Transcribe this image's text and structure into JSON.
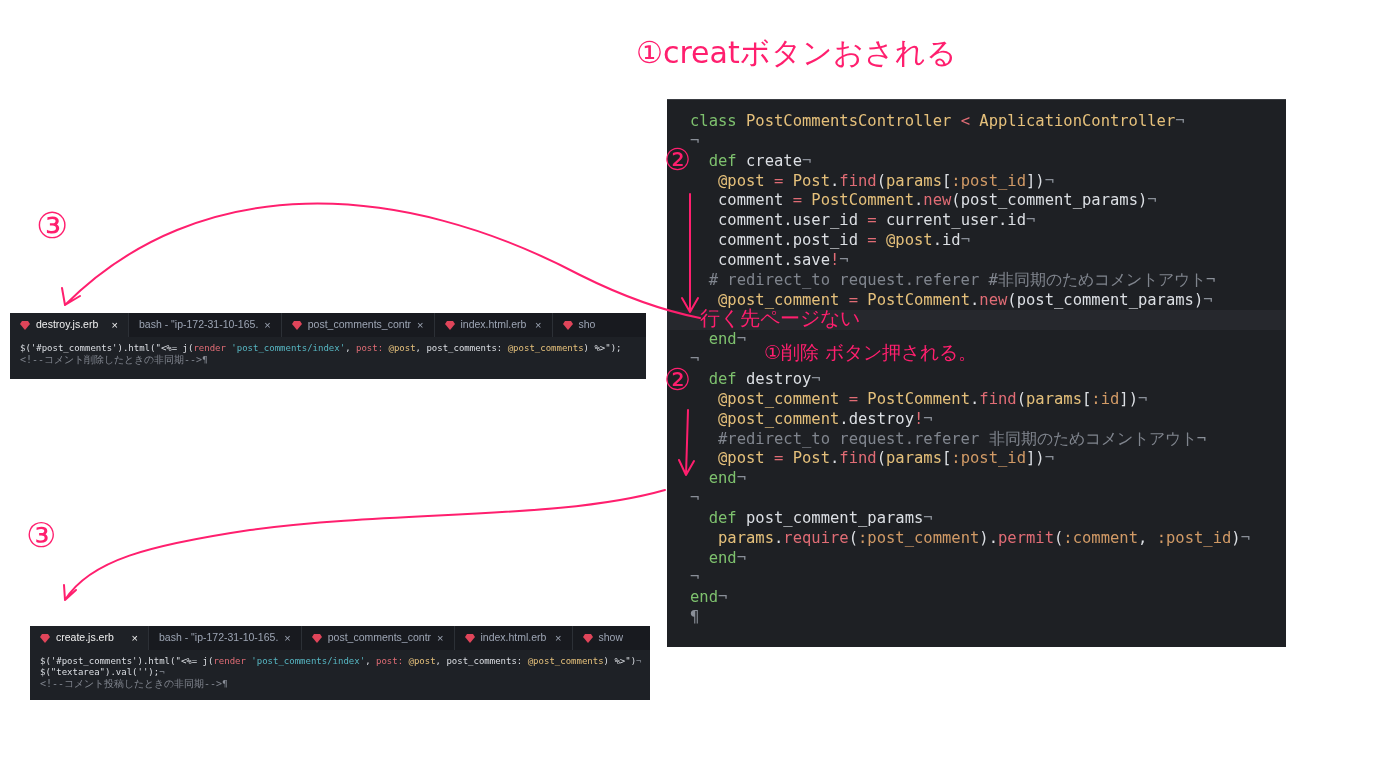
{
  "notes": [
    {
      "text": "①creatボタンおされる"
    },
    {
      "text": "②"
    },
    {
      "text": "行く先ページない"
    },
    {
      "text": "①削除 ボタン押される。"
    },
    {
      "text": "②"
    },
    {
      "text": "③"
    },
    {
      "text": "③"
    }
  ],
  "editor": {
    "lines": [
      {
        "tokens": [
          {
            "text": "class ",
            "kind": "kw"
          },
          {
            "text": "PostCommentsController",
            "kind": "cn"
          },
          {
            "text": " < ",
            "kind": "fn"
          },
          {
            "text": "ApplicationController",
            "kind": "cn"
          },
          {
            "text": "¬",
            "kind": "ws"
          }
        ]
      },
      {
        "tokens": [
          {
            "text": "¬",
            "kind": "ws"
          }
        ]
      },
      {
        "tokens": [
          {
            "text": "  def ",
            "kind": "kw"
          },
          {
            "text": "create",
            "kind": "tx"
          },
          {
            "text": "¬",
            "kind": "ws"
          }
        ]
      },
      {
        "tokens": [
          {
            "text": "   @post",
            "kind": "iv"
          },
          {
            "text": " = ",
            "kind": "fn"
          },
          {
            "text": "Post",
            "kind": "cn"
          },
          {
            "text": ".",
            "kind": "tx"
          },
          {
            "text": "find",
            "kind": "fn"
          },
          {
            "text": "(",
            "kind": "tx"
          },
          {
            "text": "params",
            "kind": "cn"
          },
          {
            "text": "[",
            "kind": "tx"
          },
          {
            "text": ":post_id",
            "kind": "sy"
          },
          {
            "text": "])",
            "kind": "tx"
          },
          {
            "text": "¬",
            "kind": "ws"
          }
        ]
      },
      {
        "tokens": [
          {
            "text": "   comment",
            "kind": "tx"
          },
          {
            "text": " = ",
            "kind": "fn"
          },
          {
            "text": "PostComment",
            "kind": "cn"
          },
          {
            "text": ".",
            "kind": "tx"
          },
          {
            "text": "new",
            "kind": "fn"
          },
          {
            "text": "(post_comment_params)",
            "kind": "tx"
          },
          {
            "text": "¬",
            "kind": "ws"
          }
        ]
      },
      {
        "tokens": [
          {
            "text": "   comment.user_id",
            "kind": "tx"
          },
          {
            "text": " = ",
            "kind": "fn"
          },
          {
            "text": "current_user.id",
            "kind": "tx"
          },
          {
            "text": "¬",
            "kind": "ws"
          }
        ]
      },
      {
        "tokens": [
          {
            "text": "   comment.post_id",
            "kind": "tx"
          },
          {
            "text": " = ",
            "kind": "fn"
          },
          {
            "text": "@post",
            "kind": "iv"
          },
          {
            "text": ".id",
            "kind": "tx"
          },
          {
            "text": "¬",
            "kind": "ws"
          }
        ]
      },
      {
        "tokens": [
          {
            "text": "   comment.save",
            "kind": "tx"
          },
          {
            "text": "!",
            "kind": "fn"
          },
          {
            "text": "¬",
            "kind": "ws"
          }
        ]
      },
      {
        "tokens": [
          {
            "text": "  # redirect_to request.referer #非同期のためコメントアウト",
            "kind": "cm"
          },
          {
            "text": "¬",
            "kind": "ws"
          }
        ]
      },
      {
        "tokens": [
          {
            "text": "   @post_comment",
            "kind": "iv"
          },
          {
            "text": " = ",
            "kind": "fn"
          },
          {
            "text": "PostComment",
            "kind": "cn"
          },
          {
            "text": ".",
            "kind": "tx"
          },
          {
            "text": "new",
            "kind": "fn"
          },
          {
            "text": "(post_comment_params)",
            "kind": "tx"
          },
          {
            "text": "¬",
            "kind": "ws"
          }
        ]
      },
      {
        "tokens": [
          {
            "text": "  end",
            "kind": "kw"
          },
          {
            "text": "¬",
            "kind": "ws"
          }
        ]
      },
      {
        "tokens": [
          {
            "text": "¬",
            "kind": "ws"
          }
        ]
      },
      {
        "tokens": [
          {
            "text": "  def ",
            "kind": "kw"
          },
          {
            "text": "destroy",
            "kind": "tx"
          },
          {
            "text": "¬",
            "kind": "ws"
          }
        ]
      },
      {
        "tokens": [
          {
            "text": "   @post_comment",
            "kind": "iv"
          },
          {
            "text": " = ",
            "kind": "fn"
          },
          {
            "text": "PostComment",
            "kind": "cn"
          },
          {
            "text": ".",
            "kind": "tx"
          },
          {
            "text": "find",
            "kind": "fn"
          },
          {
            "text": "(",
            "kind": "tx"
          },
          {
            "text": "params",
            "kind": "cn"
          },
          {
            "text": "[",
            "kind": "tx"
          },
          {
            "text": ":id",
            "kind": "sy"
          },
          {
            "text": "])",
            "kind": "tx"
          },
          {
            "text": "¬",
            "kind": "ws"
          }
        ]
      },
      {
        "tokens": [
          {
            "text": "   @post_comment",
            "kind": "iv"
          },
          {
            "text": ".destroy",
            "kind": "tx"
          },
          {
            "text": "!",
            "kind": "fn"
          },
          {
            "text": "¬",
            "kind": "ws"
          }
        ]
      },
      {
        "tokens": [
          {
            "text": "   #redirect_to request.referer 非同期のためコメントアウト",
            "kind": "cm"
          },
          {
            "text": "¬",
            "kind": "ws"
          }
        ]
      },
      {
        "tokens": [
          {
            "text": "   @post",
            "kind": "iv"
          },
          {
            "text": " = ",
            "kind": "fn"
          },
          {
            "text": "Post",
            "kind": "cn"
          },
          {
            "text": ".",
            "kind": "tx"
          },
          {
            "text": "find",
            "kind": "fn"
          },
          {
            "text": "(",
            "kind": "tx"
          },
          {
            "text": "params",
            "kind": "cn"
          },
          {
            "text": "[",
            "kind": "tx"
          },
          {
            "text": ":post_id",
            "kind": "sy"
          },
          {
            "text": "])",
            "kind": "tx"
          },
          {
            "text": "¬",
            "kind": "ws"
          }
        ]
      },
      {
        "tokens": [
          {
            "text": "  end",
            "kind": "kw"
          },
          {
            "text": "¬",
            "kind": "ws"
          }
        ]
      },
      {
        "tokens": [
          {
            "text": "¬",
            "kind": "ws"
          }
        ]
      },
      {
        "tokens": [
          {
            "text": "  def ",
            "kind": "kw"
          },
          {
            "text": "post_comment_params",
            "kind": "tx"
          },
          {
            "text": "¬",
            "kind": "ws"
          }
        ]
      },
      {
        "tokens": [
          {
            "text": "   params",
            "kind": "cn"
          },
          {
            "text": ".",
            "kind": "tx"
          },
          {
            "text": "require",
            "kind": "fn"
          },
          {
            "text": "(",
            "kind": "tx"
          },
          {
            "text": ":post_comment",
            "kind": "sy"
          },
          {
            "text": ").",
            "kind": "tx"
          },
          {
            "text": "permit",
            "kind": "fn"
          },
          {
            "text": "(",
            "kind": "tx"
          },
          {
            "text": ":comment",
            "kind": "sy"
          },
          {
            "text": ", ",
            "kind": "tx"
          },
          {
            "text": ":post_id",
            "kind": "sy"
          },
          {
            "text": ")",
            "kind": "tx"
          },
          {
            "text": "¬",
            "kind": "ws"
          }
        ]
      },
      {
        "tokens": [
          {
            "text": "  end",
            "kind": "kw"
          },
          {
            "text": "¬",
            "kind": "ws"
          }
        ]
      },
      {
        "tokens": [
          {
            "text": "¬",
            "kind": "ws"
          }
        ]
      },
      {
        "tokens": [
          {
            "text": "end",
            "kind": "kw"
          },
          {
            "text": "¬",
            "kind": "ws"
          }
        ]
      },
      {
        "tokens": [
          {
            "text": "¶",
            "kind": "ws"
          }
        ]
      }
    ]
  },
  "snippets": [
    {
      "tabs": [
        {
          "label": "destroy.js.erb",
          "selected": true,
          "kind": "file",
          "close": "×"
        },
        {
          "label": "bash - \"ip-172-31-10-165.",
          "selected": false,
          "kind": "terminal",
          "close": "×"
        },
        {
          "label": "post_comments_contr",
          "selected": false,
          "kind": "file",
          "close": "×"
        },
        {
          "label": "index.html.erb",
          "selected": false,
          "kind": "file",
          "close": "×"
        },
        {
          "label": "sho",
          "selected": false,
          "kind": "file"
        }
      ],
      "lines": [
        {
          "tokens": [
            {
              "text": "$('#post_comments').html(\"<%= j(",
              "kind": "tx"
            },
            {
              "text": "render ",
              "kind": "fn"
            },
            {
              "text": "'post_comments/index'",
              "kind": "st"
            },
            {
              "text": ", ",
              "kind": "tx"
            },
            {
              "text": "post: ",
              "kind": "fn"
            },
            {
              "text": "@post",
              "kind": "iv"
            },
            {
              "text": ", post_comments: ",
              "kind": "tx"
            },
            {
              "text": "@post_comments",
              "kind": "iv"
            },
            {
              "text": ") %>\");",
              "kind": "tx"
            }
          ]
        },
        {
          "tokens": [
            {
              "text": "<!--コメント削除したときの非同期-->",
              "kind": "cm"
            },
            {
              "text": "¶",
              "kind": "ws"
            }
          ]
        }
      ]
    },
    {
      "tabs": [
        {
          "label": "create.js.erb",
          "selected": true,
          "kind": "file",
          "close": "×"
        },
        {
          "label": "bash - \"ip-172-31-10-165.",
          "selected": false,
          "kind": "terminal",
          "close": "×"
        },
        {
          "label": "post_comments_contr",
          "selected": false,
          "kind": "file",
          "close": "×"
        },
        {
          "label": "index.html.erb",
          "selected": false,
          "kind": "file",
          "close": "×"
        },
        {
          "label": "show",
          "selected": false,
          "kind": "file"
        }
      ],
      "lines": [
        {
          "tokens": [
            {
              "text": "$('#post_comments').html(\"<%= j(",
              "kind": "tx"
            },
            {
              "text": "render ",
              "kind": "fn"
            },
            {
              "text": "'post_comments/index'",
              "kind": "st"
            },
            {
              "text": ", ",
              "kind": "tx"
            },
            {
              "text": "post: ",
              "kind": "fn"
            },
            {
              "text": "@post",
              "kind": "iv"
            },
            {
              "text": ", post_comments: ",
              "kind": "tx"
            },
            {
              "text": "@post_comments",
              "kind": "iv"
            },
            {
              "text": ") %>\")",
              "kind": "tx"
            },
            {
              "text": "¬",
              "kind": "ws"
            }
          ]
        },
        {
          "tokens": [
            {
              "text": "$(\"textarea\").val('');",
              "kind": "tx"
            },
            {
              "text": "¬",
              "kind": "ws"
            }
          ]
        },
        {
          "tokens": [
            {
              "text": "<!--コメント投稿したときの非同期-->",
              "kind": "cm"
            },
            {
              "text": "¶",
              "kind": "ws"
            }
          ]
        }
      ]
    }
  ]
}
